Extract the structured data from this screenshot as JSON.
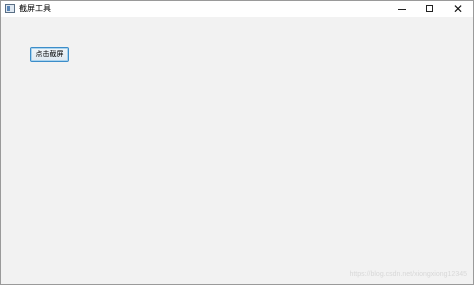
{
  "window": {
    "title": "截屏工具",
    "controls": {
      "minimize_icon": "minimize-icon",
      "maximize_icon": "maximize-icon",
      "close_icon": "close-icon"
    }
  },
  "main": {
    "capture_button_label": "点击截屏"
  },
  "watermark": "https://blog.csdn.net/xiongxiong12345"
}
